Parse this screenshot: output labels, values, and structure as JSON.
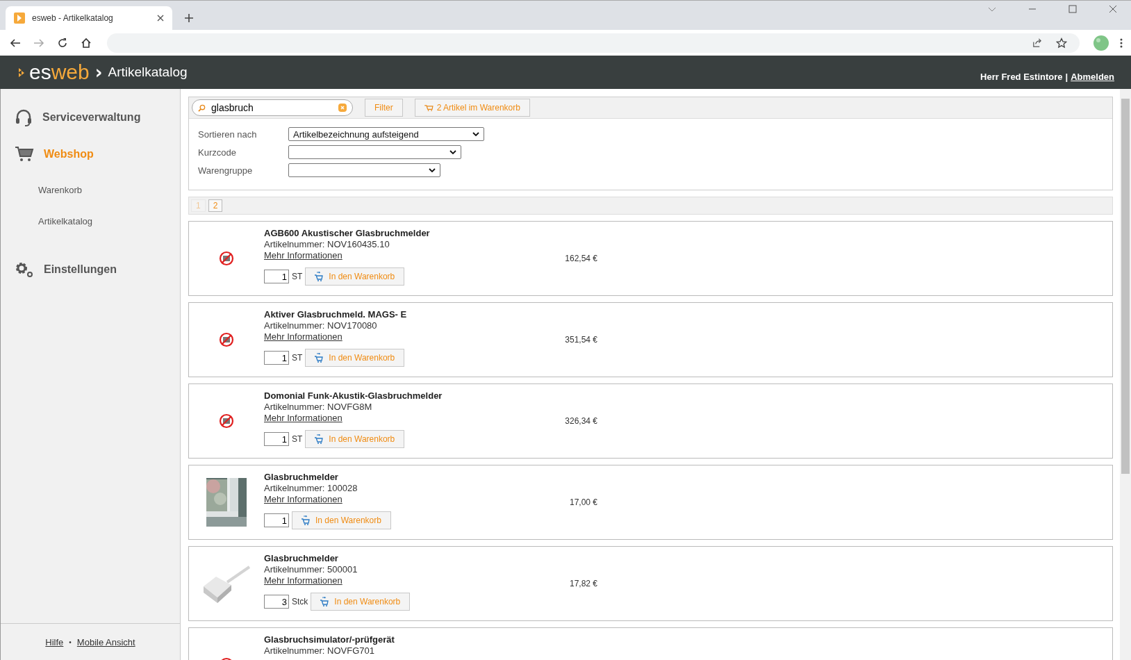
{
  "browser": {
    "tab_title": "esweb - Artikelkatalog"
  },
  "header": {
    "logo_left": "es",
    "logo_right": "web",
    "separator": "›",
    "page_title": "Artikelkatalog",
    "user": "Herr Fred Estintore",
    "divider": "|",
    "logout": "Abmelden"
  },
  "sidebar": {
    "items": [
      {
        "label": "Serviceverwaltung",
        "kind": "headset",
        "selected": false
      },
      {
        "label": "Webshop",
        "kind": "cart",
        "selected": true,
        "children": [
          {
            "label": "Warenkorb"
          },
          {
            "label": "Artikelkatalog"
          }
        ]
      },
      {
        "label": "Einstellungen",
        "kind": "gear",
        "selected": false
      }
    ],
    "footer": {
      "links": [
        "Hilfe",
        "Mobile Ansicht"
      ],
      "separator": "•"
    }
  },
  "search": {
    "value": "glasbruch",
    "filter_button": "Filter",
    "cart_button": "2 Artikel im Warenkorb"
  },
  "filters": [
    {
      "label": "Sortieren nach",
      "value": "Artikelbezeichnung aufsteigend"
    },
    {
      "label": "Kurzcode"
    },
    {
      "label": "Warengruppe"
    }
  ],
  "pagination": [
    {
      "label": "1",
      "selected": true
    },
    {
      "label": "2",
      "selected": false
    }
  ],
  "products": [
    {
      "kind": "no-image",
      "title": "AGB600 Akustischer Glasbruchmelder",
      "number": "Artikelnummer: NOV160435.10",
      "link": "Mehr Informationen",
      "quantity": "1",
      "unit": "ST",
      "button": "In den Warenkorb",
      "price": "162,54 €"
    },
    {
      "kind": "no-image",
      "title": "Aktiver Glasbruchmeld. MAGS- E",
      "number": "Artikelnummer: NOV170080",
      "link": "Mehr Informationen",
      "quantity": "1",
      "unit": "ST",
      "button": "In den Warenkorb",
      "price": "351,54 €"
    },
    {
      "kind": "no-image",
      "title": "Domonial Funk-Akustik-Glasbruchmelder",
      "number": "Artikelnummer: NOVFG8M",
      "link": "Mehr Informationen",
      "quantity": "1",
      "unit": "ST",
      "button": "In den Warenkorb",
      "price": "326,34 €"
    },
    {
      "kind": "window",
      "title": "Glasbruchmelder",
      "number": "Artikelnummer: 100028",
      "link": "Mehr Informationen",
      "quantity": "1",
      "button": "In den Warenkorb",
      "price": "17,00 €"
    },
    {
      "kind": "sensor",
      "title": "Glasbruchmelder",
      "number": "Artikelnummer: 500001",
      "link": "Mehr Informationen",
      "quantity": "3",
      "unit": "Stck",
      "button": "In den Warenkorb",
      "price": "17,82 €"
    },
    {
      "kind": "no-image",
      "title": "Glasbruchsimulator/-prüfgerät",
      "number": "Artikelnummer: NOVFG701"
    }
  ]
}
